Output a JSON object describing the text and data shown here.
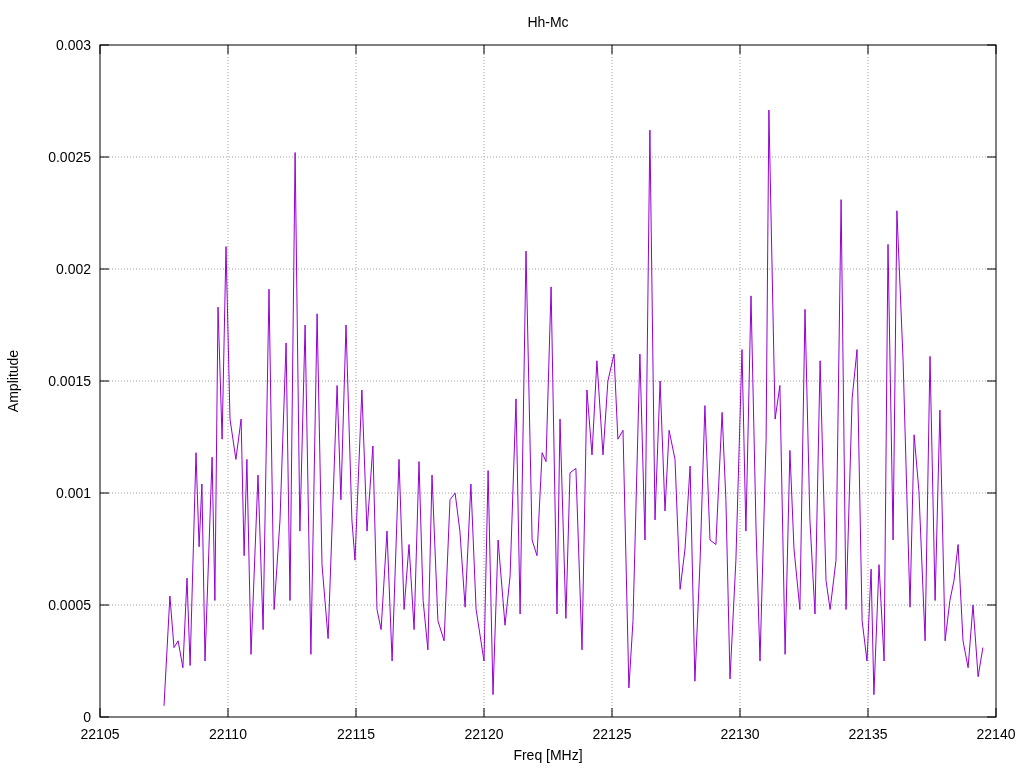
{
  "chart_data": {
    "type": "line",
    "grid": true,
    "title": "Hh-Mc",
    "xlabel": "Freq [MHz]",
    "ylabel": "Amplitude",
    "xlim": [
      22105,
      22140
    ],
    "ylim": [
      0,
      0.003
    ],
    "xticks": [
      22105,
      22110,
      22115,
      22120,
      22125,
      22130,
      22135,
      22140
    ],
    "yticks": [
      0,
      0.0005,
      0.001,
      0.0015,
      0.002,
      0.0025,
      0.003
    ],
    "x": [
      22107.5,
      22107.73,
      22107.89,
      22108.05,
      22108.24,
      22108.4,
      22108.52,
      22108.75,
      22108.87,
      22108.98,
      22109.1,
      22109.38,
      22109.49,
      22109.61,
      22109.77,
      22109.92,
      22110.08,
      22110.31,
      22110.51,
      22110.63,
      22110.74,
      22110.9,
      22111.17,
      22111.37,
      22111.6,
      22111.8,
      22112.03,
      22112.27,
      22112.42,
      22112.62,
      22112.81,
      22113.01,
      22113.24,
      22113.48,
      22113.67,
      22113.91,
      22114.26,
      22114.41,
      22114.61,
      22114.84,
      22114.96,
      22115.23,
      22115.43,
      22115.66,
      22115.82,
      22115.98,
      22116.21,
      22116.41,
      22116.68,
      22116.88,
      22117.07,
      22117.27,
      22117.46,
      22117.62,
      22117.81,
      22117.97,
      22118.2,
      22118.44,
      22118.67,
      22118.87,
      22119.06,
      22119.26,
      22119.49,
      22119.69,
      22120.0,
      22120.16,
      22120.35,
      22120.55,
      22120.82,
      22121.02,
      22121.25,
      22121.41,
      22121.64,
      22121.88,
      22122.07,
      22122.27,
      22122.42,
      22122.62,
      22122.85,
      22122.97,
      22123.2,
      22123.36,
      22123.59,
      22123.83,
      22124.02,
      22124.22,
      22124.41,
      22124.65,
      22124.84,
      22125.08,
      22125.23,
      22125.43,
      22125.66,
      22125.82,
      22126.09,
      22126.29,
      22126.48,
      22126.68,
      22126.88,
      22127.07,
      22127.23,
      22127.46,
      22127.66,
      22127.85,
      22128.05,
      22128.24,
      22128.44,
      22128.63,
      22128.83,
      22129.06,
      22129.3,
      22129.45,
      22129.61,
      22129.84,
      22130.08,
      22130.23,
      22130.43,
      22130.63,
      22130.78,
      22131.02,
      22131.13,
      22131.37,
      22131.56,
      22131.76,
      22131.95,
      22132.11,
      22132.34,
      22132.54,
      22132.73,
      22132.93,
      22133.13,
      22133.36,
      22133.52,
      22133.75,
      22133.95,
      22134.14,
      22134.38,
      22134.57,
      22134.77,
      22134.96,
      22135.12,
      22135.23,
      22135.43,
      22135.63,
      22135.78,
      22135.98,
      22136.13,
      22136.37,
      22136.64,
      22136.8,
      22136.99,
      22137.23,
      22137.42,
      22137.62,
      22137.81,
      22138.01,
      22138.2,
      22138.36,
      22138.52,
      22138.71,
      22138.91,
      22139.1,
      22139.3,
      22139.49
    ],
    "series": [
      {
        "color": "#9400d3",
        "values": [
          5e-05,
          0.00054,
          0.00031,
          0.00034,
          0.00022,
          0.00062,
          0.00023,
          0.00118,
          0.00076,
          0.00104,
          0.00025,
          0.00116,
          0.00052,
          0.00183,
          0.00124,
          0.0021,
          0.00133,
          0.00115,
          0.00133,
          0.00072,
          0.00115,
          0.00028,
          0.00108,
          0.00039,
          0.00191,
          0.00048,
          0.00088,
          0.00167,
          0.00052,
          0.00252,
          0.00083,
          0.00175,
          0.00028,
          0.0018,
          0.00068,
          0.00035,
          0.00148,
          0.00097,
          0.00175,
          0.00088,
          0.0007,
          0.00146,
          0.00083,
          0.00121,
          0.00048,
          0.00039,
          0.00083,
          0.00025,
          0.00115,
          0.00048,
          0.00077,
          0.00039,
          0.00114,
          0.00052,
          0.0003,
          0.00108,
          0.00043,
          0.00034,
          0.00097,
          0.001,
          0.00083,
          0.00049,
          0.00104,
          0.00048,
          0.00025,
          0.0011,
          0.0001,
          0.00079,
          0.00041,
          0.00063,
          0.00142,
          0.00046,
          0.00208,
          0.00079,
          0.00072,
          0.00118,
          0.00114,
          0.00192,
          0.00046,
          0.00133,
          0.00044,
          0.00109,
          0.00111,
          0.0003,
          0.00146,
          0.00117,
          0.00159,
          0.00117,
          0.0015,
          0.00162,
          0.00124,
          0.00128,
          0.00013,
          0.00043,
          0.00162,
          0.00079,
          0.00262,
          0.00088,
          0.0015,
          0.00092,
          0.00128,
          0.00115,
          0.00057,
          0.00075,
          0.00112,
          0.00016,
          0.0007,
          0.00139,
          0.00079,
          0.00077,
          0.00136,
          0.00097,
          0.00017,
          0.0007,
          0.00164,
          0.00083,
          0.00188,
          0.00083,
          0.00025,
          0.00124,
          0.00271,
          0.00133,
          0.00148,
          0.00028,
          0.00119,
          0.00075,
          0.00048,
          0.00182,
          0.00088,
          0.00046,
          0.00159,
          0.00061,
          0.00048,
          0.0007,
          0.00231,
          0.00048,
          0.00142,
          0.00164,
          0.00043,
          0.00025,
          0.00066,
          0.0001,
          0.00068,
          0.00025,
          0.00211,
          0.00079,
          0.00226,
          0.00159,
          0.00049,
          0.00126,
          0.00101,
          0.00034,
          0.00161,
          0.00052,
          0.00137,
          0.00034,
          0.00052,
          0.00061,
          0.00077,
          0.00034,
          0.00022,
          0.0005,
          0.00018,
          0.00031
        ]
      }
    ]
  }
}
